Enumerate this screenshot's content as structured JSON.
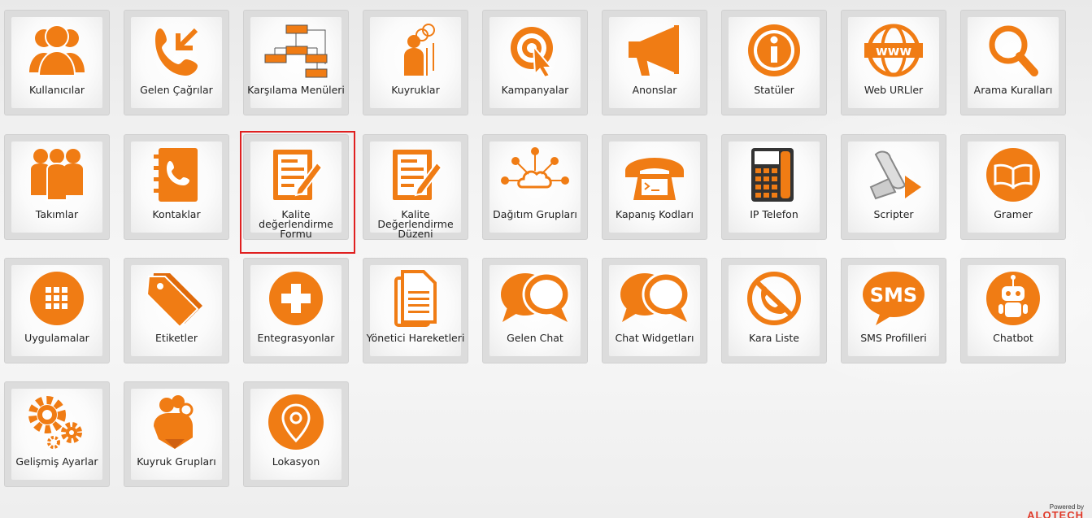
{
  "colors": {
    "accent": "#f07c14",
    "selection": "#e02020"
  },
  "tiles": [
    {
      "label": "Kullanıcılar",
      "icon": "users-icon"
    },
    {
      "label": "Gelen Çağrılar",
      "icon": "incoming-call-icon"
    },
    {
      "label": "Karşılama Menüleri",
      "icon": "flowchart-icon"
    },
    {
      "label": "Kuyruklar",
      "icon": "queue-people-icon"
    },
    {
      "label": "Kampanyalar",
      "icon": "target-cursor-icon"
    },
    {
      "label": "Anonslar",
      "icon": "megaphone-icon"
    },
    {
      "label": "Statüler",
      "icon": "info-icon"
    },
    {
      "label": "Web URLler",
      "icon": "www-globe-icon"
    },
    {
      "label": "Arama Kuralları",
      "icon": "magnifier-icon"
    },
    {
      "label": "Takımlar",
      "icon": "team-icon"
    },
    {
      "label": "Kontaklar",
      "icon": "contact-book-icon"
    },
    {
      "label": "Kalite değerlendirme Formu",
      "icon": "form-edit-icon"
    },
    {
      "label": "Kalite Değerlendirme Düzeni",
      "icon": "form-edit-icon"
    },
    {
      "label": "Dağıtım Grupları",
      "icon": "cloud-network-icon"
    },
    {
      "label": "Kapanış Kodları",
      "icon": "phone-terminal-icon"
    },
    {
      "label": "IP Telefon",
      "icon": "desk-phone-icon"
    },
    {
      "label": "Scripter",
      "icon": "script-scroll-icon"
    },
    {
      "label": "Gramer",
      "icon": "book-icon"
    },
    {
      "label": "Uygulamalar",
      "icon": "app-grid-icon"
    },
    {
      "label": "Etiketler",
      "icon": "tags-icon"
    },
    {
      "label": "Entegrasyonlar",
      "icon": "plus-circle-icon"
    },
    {
      "label": "Yönetici Hareketleri",
      "icon": "documents-icon"
    },
    {
      "label": "Gelen Chat",
      "icon": "chat-bubbles-icon"
    },
    {
      "label": "Chat Widgetları",
      "icon": "chat-bubbles-icon"
    },
    {
      "label": "Kara Liste",
      "icon": "blocked-phone-icon"
    },
    {
      "label": "SMS Profilleri",
      "icon": "sms-bubble-icon"
    },
    {
      "label": "Chatbot",
      "icon": "robot-icon"
    },
    {
      "label": "Gelişmiş Ayarlar",
      "icon": "gears-icon"
    },
    {
      "label": "Kuyruk Grupları",
      "icon": "group-pointer-icon"
    },
    {
      "label": "Lokasyon",
      "icon": "location-pin-icon"
    }
  ],
  "selected_tile": "Kalite değerlendirme Formu",
  "footer": {
    "powered_by": "Powered by",
    "brand": "ALOTECH"
  }
}
